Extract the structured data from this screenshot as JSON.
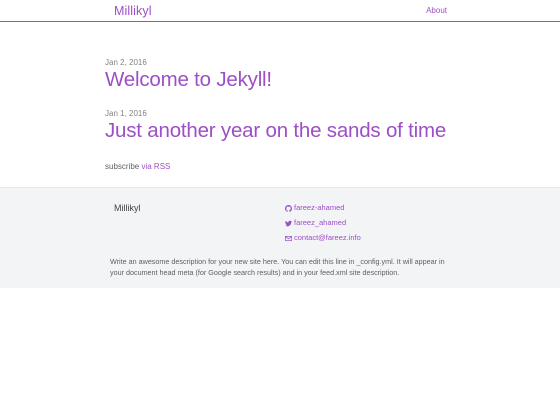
{
  "header": {
    "site_title": "Millikyl",
    "nav": [
      {
        "label": "About"
      }
    ]
  },
  "posts": [
    {
      "date": "Jan 2, 2016",
      "title": "Welcome to Jekyll!"
    },
    {
      "date": "Jan 1, 2016",
      "title": "Just another year on the sands of time"
    }
  ],
  "rss": {
    "prefix": "subscribe",
    "link_label": "via RSS"
  },
  "footer": {
    "heading": "Millikyl",
    "contacts": [
      {
        "icon": "github-icon",
        "label": "fareez-ahamed"
      },
      {
        "icon": "twitter-icon",
        "label": "fareez_ahamed"
      },
      {
        "icon": "email-icon",
        "label": "contact@fareez.info"
      }
    ],
    "description": "Write an awesome description for your new site here. You can edit this line in _config.yml. It will appear in your document head meta (for Google search results) and in your feed.xml site description."
  },
  "colors": {
    "accent": "#9c4fc6",
    "footer_bg": "#f3f4f6",
    "text": "#606060"
  }
}
